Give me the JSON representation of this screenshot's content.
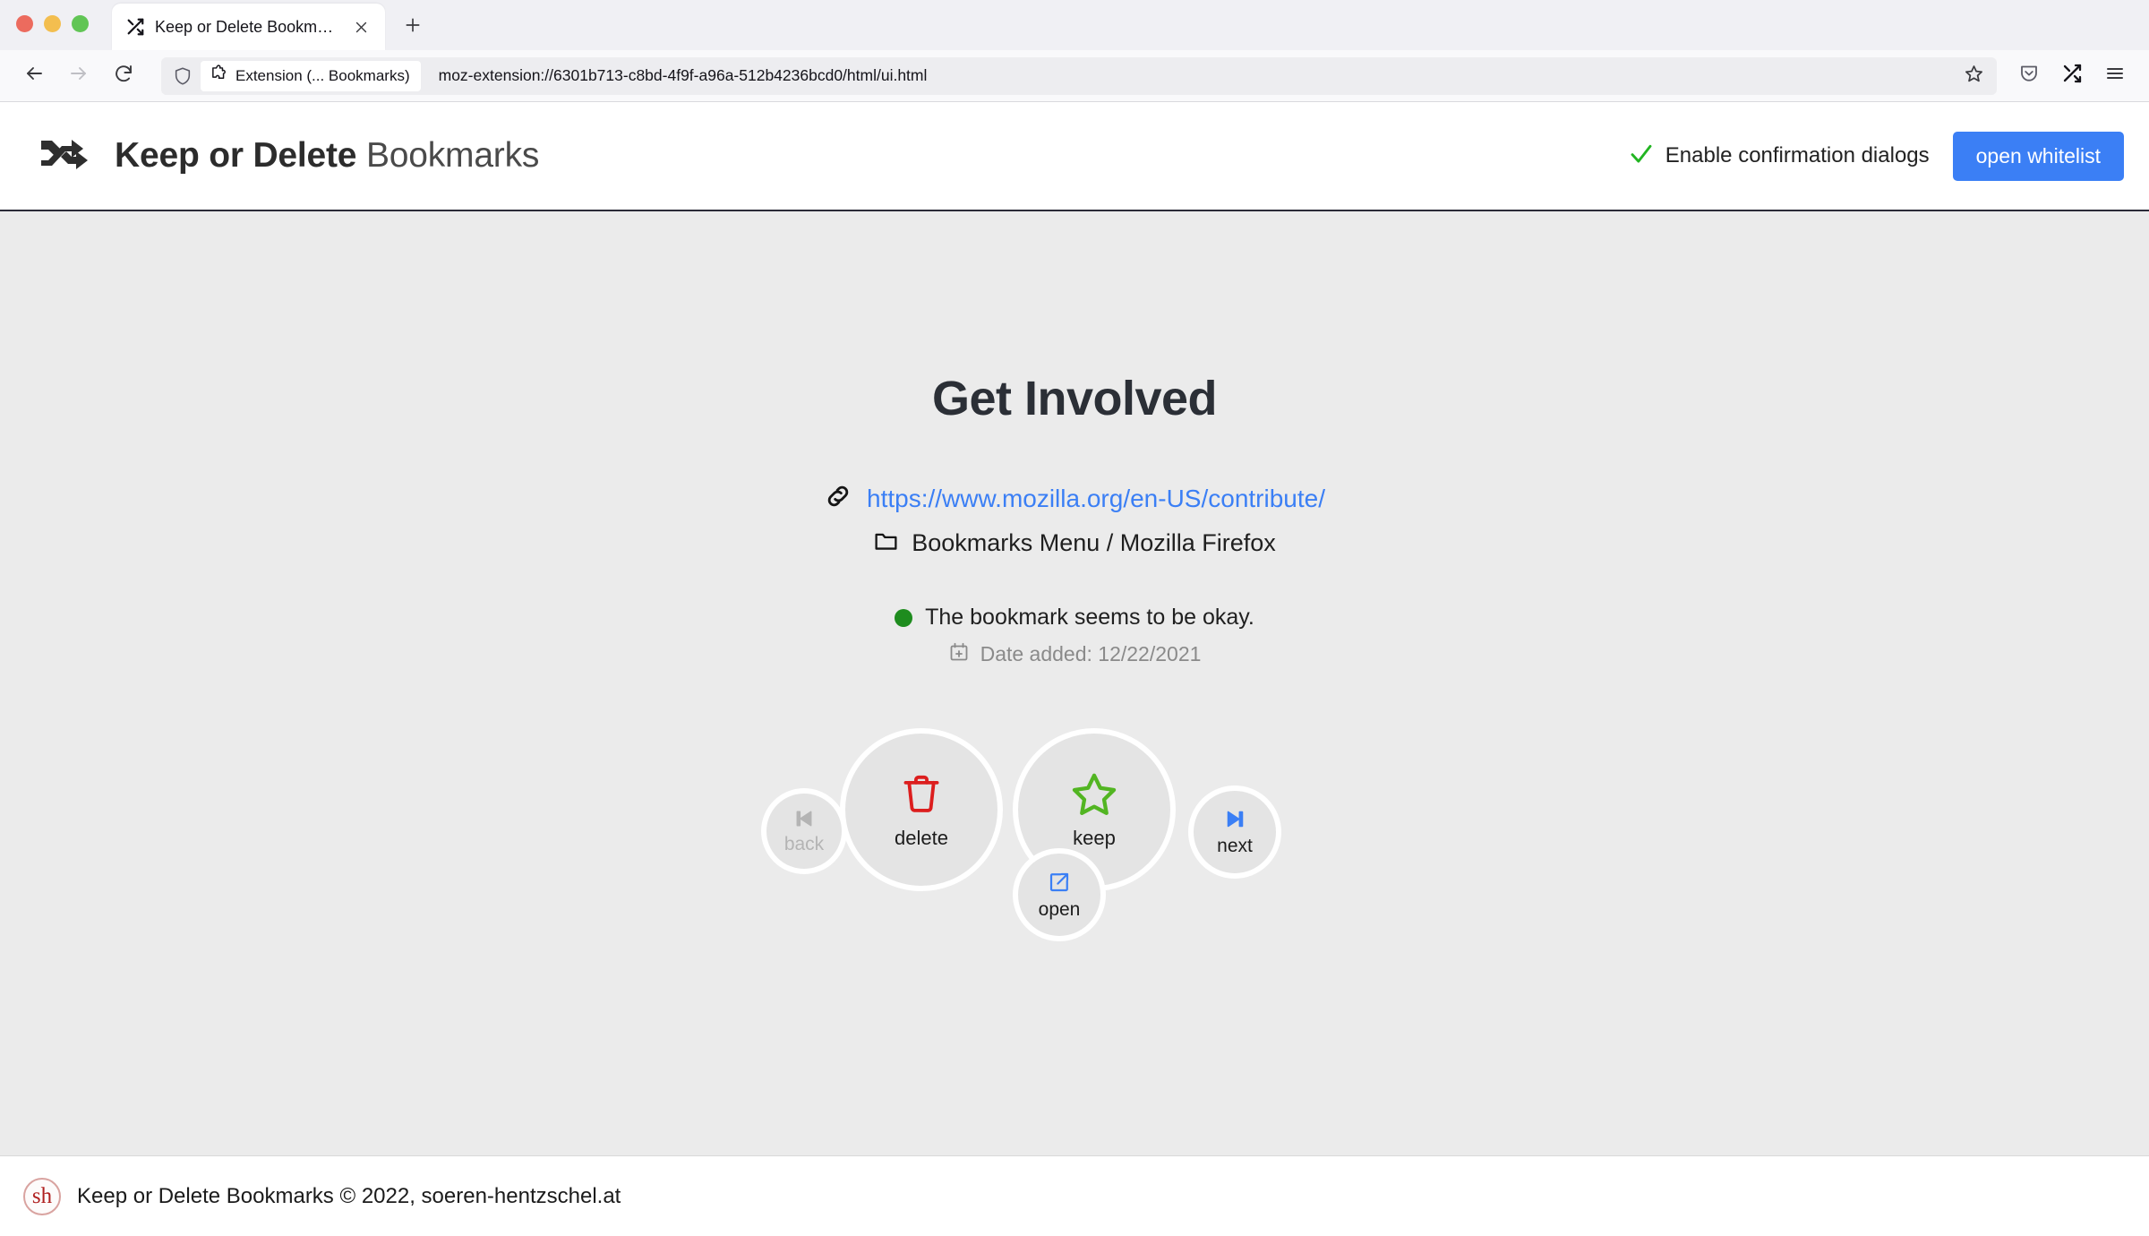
{
  "browser": {
    "tab": {
      "title": "Keep or Delete Bookmarks",
      "favicon_icon": "shuffle-icon",
      "close_icon": "close-icon"
    },
    "newtab_icon": "plus-icon",
    "nav": {
      "back_icon": "arrow-left-icon",
      "forward_icon": "arrow-right-icon",
      "reload_icon": "reload-icon"
    },
    "urlbar": {
      "shield_icon": "shield-icon",
      "identity_icon": "puzzle-piece-icon",
      "identity_label": "Extension (... Bookmarks)",
      "url": "moz-extension://6301b713-c8bd-4f9f-a96a-512b4236bcd0/html/ui.html",
      "star_icon": "star-outline-icon"
    },
    "toolbar_right": {
      "pocket_icon": "pocket-icon",
      "extension_icon": "shuffle-icon",
      "menu_icon": "hamburger-menu-icon"
    }
  },
  "app": {
    "logo_icon": "shuffle-arrows-icon",
    "title_bold": "Keep or Delete",
    "title_light": "Bookmarks",
    "confirm": {
      "check_icon": "check-icon",
      "label": "Enable confirmation dialogs",
      "checked": true,
      "check_color": "#22b522"
    },
    "whitelist_button": {
      "label": "open whitelist",
      "color": "#3b7ff5"
    }
  },
  "bookmark": {
    "title": "Get Involved",
    "link_icon": "link-icon",
    "url": "https://www.mozilla.org/en-US/contribute/",
    "url_color": "#3b7ff5",
    "folder_icon": "folder-icon",
    "folder_path": "Bookmarks Menu / Mozilla Firefox",
    "status_icon": "status-dot-icon",
    "status_color": "#1e8c1e",
    "status_text": "The bookmark seems to be okay.",
    "date_icon": "calendar-plus-icon",
    "date_label": "Date added: 12/22/2021"
  },
  "actions": [
    {
      "name": "back",
      "label": "back",
      "icon": "skip-back-icon",
      "color": "#b4b4b4",
      "enabled": false
    },
    {
      "name": "delete",
      "label": "delete",
      "icon": "trash-icon",
      "color": "#dc1e1e",
      "enabled": true
    },
    {
      "name": "keep",
      "label": "keep",
      "icon": "star-outline-icon",
      "color": "#52b522",
      "enabled": true
    },
    {
      "name": "next",
      "label": "next",
      "icon": "skip-forward-icon",
      "color": "#3b7ff5",
      "enabled": true
    },
    {
      "name": "open",
      "label": "open",
      "icon": "external-link-icon",
      "color": "#3b7ff5",
      "enabled": true
    }
  ],
  "footer": {
    "logo_text": "sh",
    "text": "Keep or Delete Bookmarks © 2022, soeren-hentzschel.at"
  }
}
